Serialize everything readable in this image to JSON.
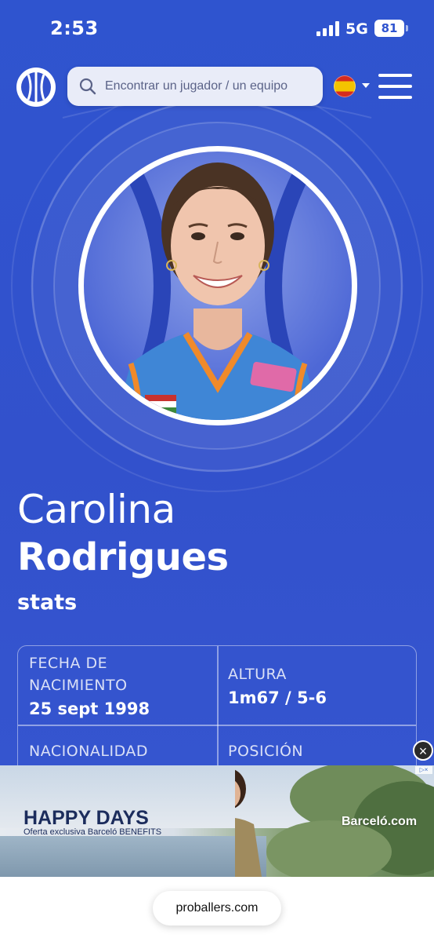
{
  "status_bar": {
    "time": "2:53",
    "network": "5G",
    "battery": "81"
  },
  "header": {
    "logo_icon": "basketball-logo-icon",
    "search_placeholder": "Encontrar un jugador / un equipo",
    "language_flag": "spain-flag-icon",
    "menu_icon": "hamburger-menu-icon"
  },
  "player": {
    "first_name": "Carolina",
    "last_name": "Rodrigues",
    "stats_link": "stats"
  },
  "info": {
    "birth_label": "FECHA DE NACIMIENTO",
    "birth_value": "25 sept 1998",
    "height_label": "ALTURA",
    "height_value": "1m67 / 5-6",
    "nationality_label": "NACIONALIDAD",
    "position_label": "POSICIÓN"
  },
  "ad": {
    "headline": "HAPPY DAYS",
    "subline": "Oferta exclusiva Barceló BENEFITS",
    "brand": "Barceló.com",
    "close_icon": "close-icon"
  },
  "browser": {
    "url": "proballers.com"
  },
  "colors": {
    "primary_blue": "#3251cc",
    "white": "#ffffff",
    "ad_navy": "#1b2c5c"
  }
}
